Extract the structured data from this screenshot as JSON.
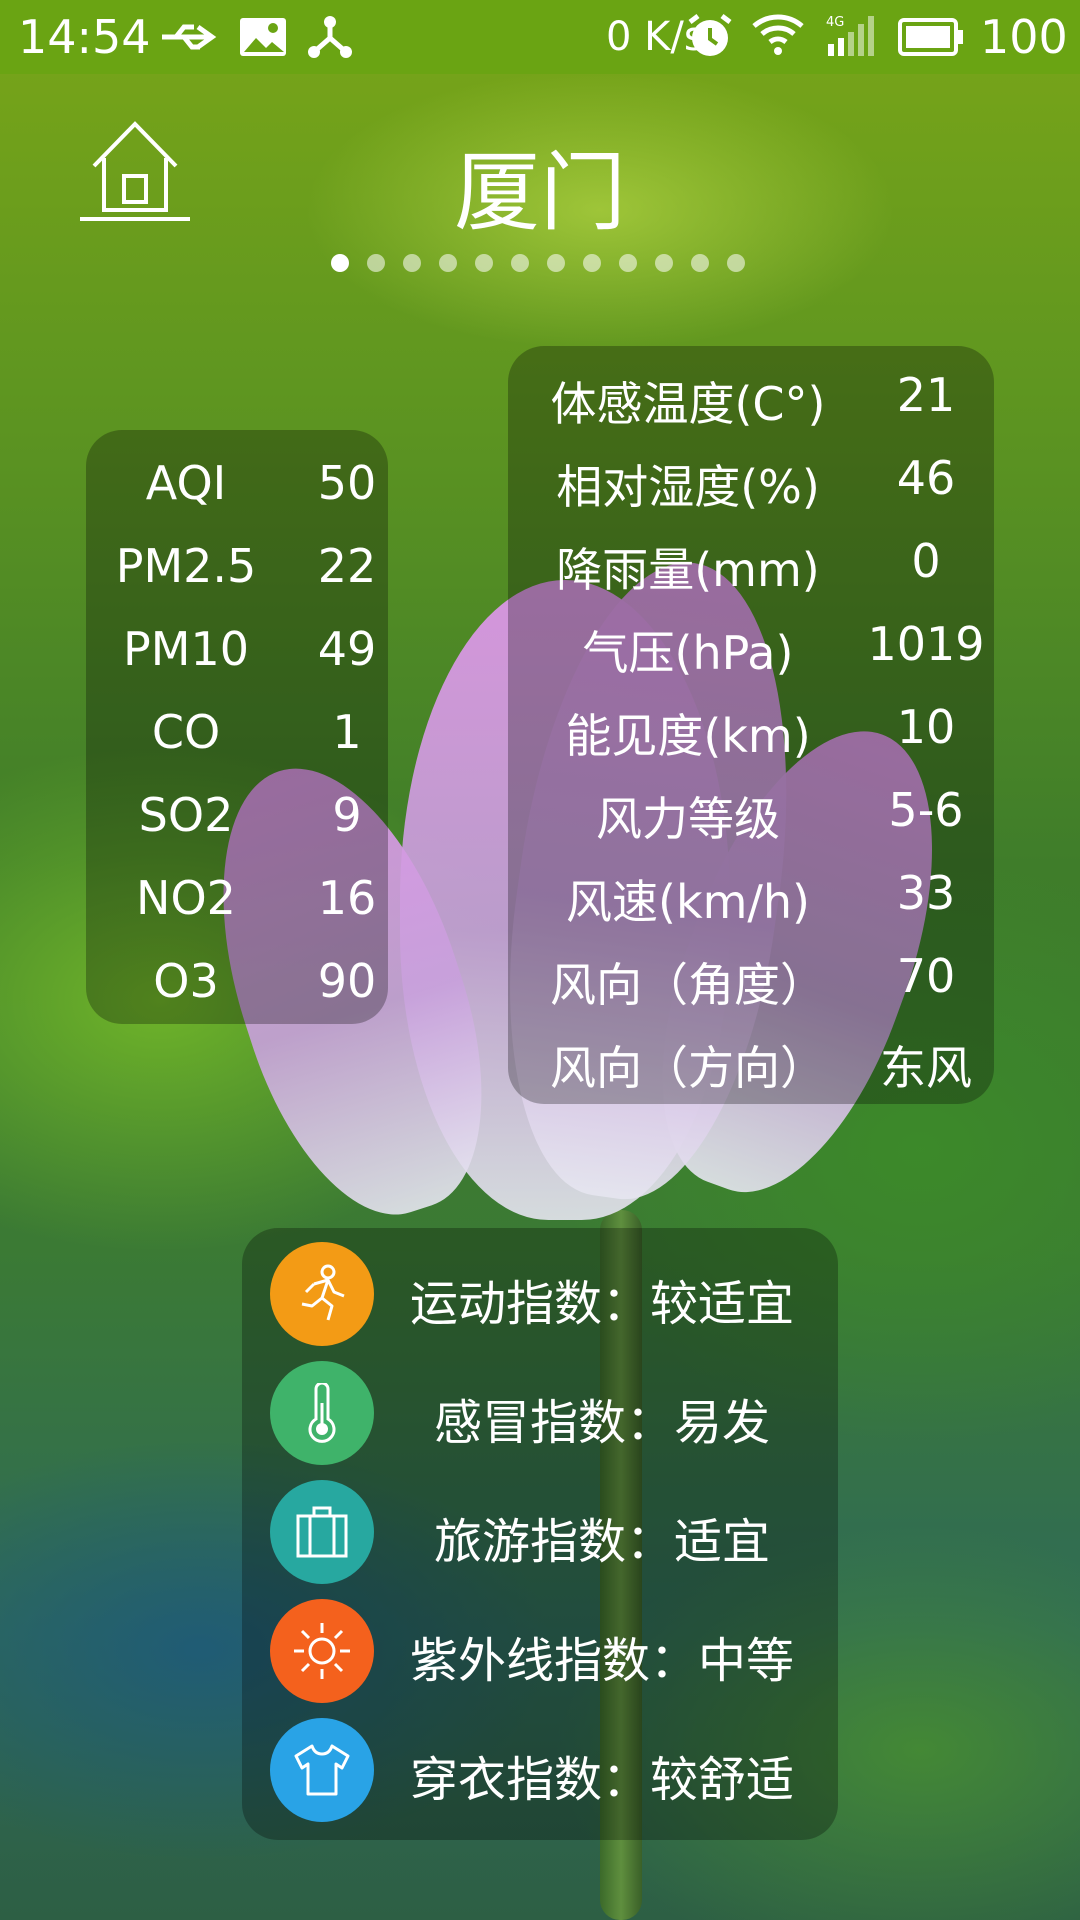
{
  "status_bar": {
    "time": "14:54",
    "net_speed": "0 K/s",
    "battery": "100"
  },
  "header": {
    "city": "厦门",
    "page_count": 12,
    "active_page": 0
  },
  "air_quality": [
    {
      "label": "AQI",
      "value": "50"
    },
    {
      "label": "PM2.5",
      "value": "22"
    },
    {
      "label": "PM10",
      "value": "49"
    },
    {
      "label": "CO",
      "value": "1"
    },
    {
      "label": "SO2",
      "value": "9"
    },
    {
      "label": "NO2",
      "value": "16"
    },
    {
      "label": "O3",
      "value": "90"
    }
  ],
  "weather": [
    {
      "label": "体感温度(C°)",
      "value": "21"
    },
    {
      "label": "相对湿度(%)",
      "value": "46"
    },
    {
      "label": "降雨量(mm)",
      "value": "0"
    },
    {
      "label": "气压(hPa)",
      "value": "1019"
    },
    {
      "label": "能见度(km)",
      "value": "10"
    },
    {
      "label": "风力等级",
      "value": "5-6"
    },
    {
      "label": "风速(km/h)",
      "value": "33"
    },
    {
      "label": "风向（角度）",
      "value": "70"
    },
    {
      "label": "风向（方向）",
      "value": "东风"
    }
  ],
  "indices": [
    {
      "text": "运动指数：较适宜",
      "icon": "running-person-icon",
      "color": "#f39b15"
    },
    {
      "text": "感冒指数：易发",
      "icon": "thermometer-icon",
      "color": "#3fb36a"
    },
    {
      "text": "旅游指数：适宜",
      "icon": "luggage-icon",
      "color": "#27a8a0"
    },
    {
      "text": "紫外线指数：中等",
      "icon": "sun-icon",
      "color": "#f4611d"
    },
    {
      "text": "穿衣指数：较舒适",
      "icon": "tshirt-icon",
      "color": "#29a3e6"
    }
  ]
}
